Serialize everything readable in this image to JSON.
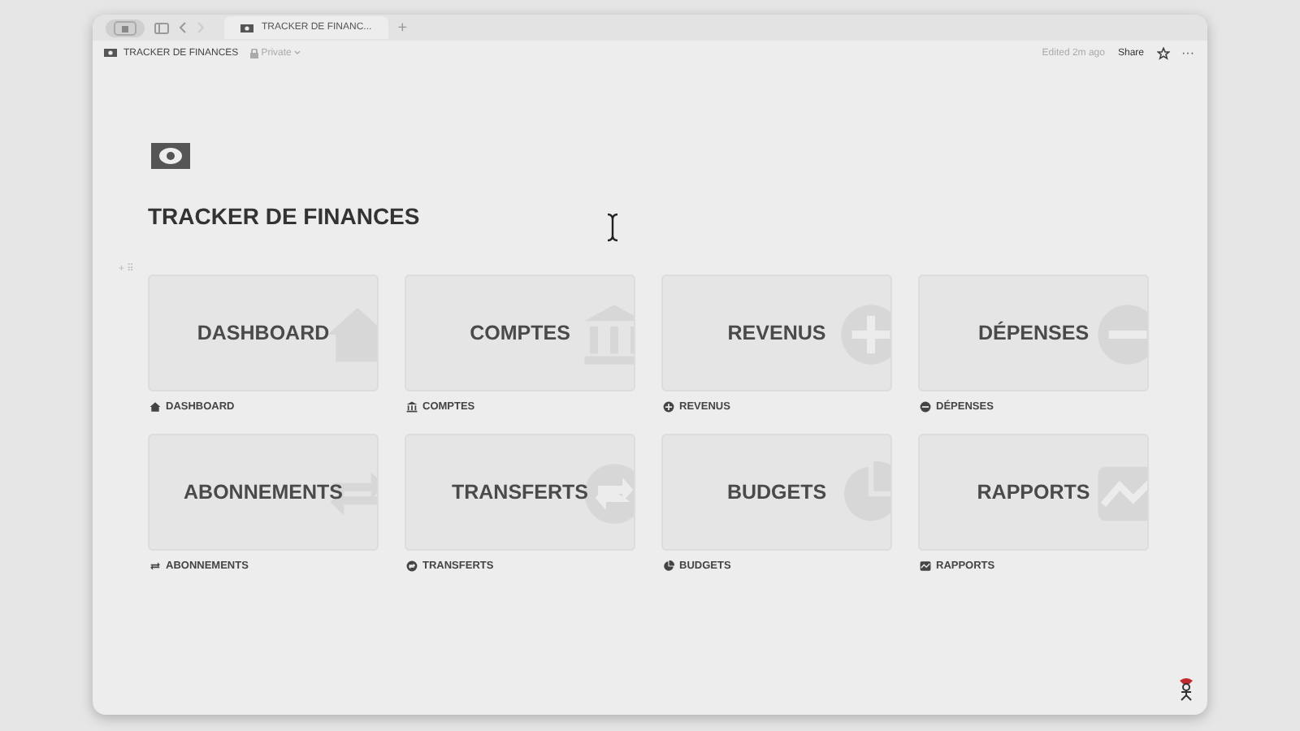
{
  "browser_tab": {
    "title": "TRACKER DE FINANC...",
    "new_tab": "+"
  },
  "header": {
    "breadcrumb": "TRACKER DE FINANCES",
    "privacy": "Private",
    "edited": "Edited 2m ago",
    "share": "Share",
    "more": "···"
  },
  "page": {
    "title": "TRACKER DE FINANCES",
    "block_handle": "+ ⠿"
  },
  "cards": [
    {
      "title": "DASHBOARD",
      "caption": "DASHBOARD",
      "kind": "house"
    },
    {
      "title": "COMPTES",
      "caption": "COMPTES",
      "kind": "bank"
    },
    {
      "title": "REVENUS",
      "caption": "REVENUS",
      "kind": "plus"
    },
    {
      "title": "DÉPENSES",
      "caption": "DÉPENSES",
      "kind": "minus"
    },
    {
      "title": "ABONNEMENTS",
      "caption": "ABONNEMENTS",
      "kind": "repeat"
    },
    {
      "title": "TRANSFERTS",
      "caption": "TRANSFERTS",
      "kind": "swap"
    },
    {
      "title": "BUDGETS",
      "caption": "BUDGETS",
      "kind": "pie"
    },
    {
      "title": "RAPPORTS",
      "caption": "RAPPORTS",
      "kind": "chart"
    }
  ]
}
